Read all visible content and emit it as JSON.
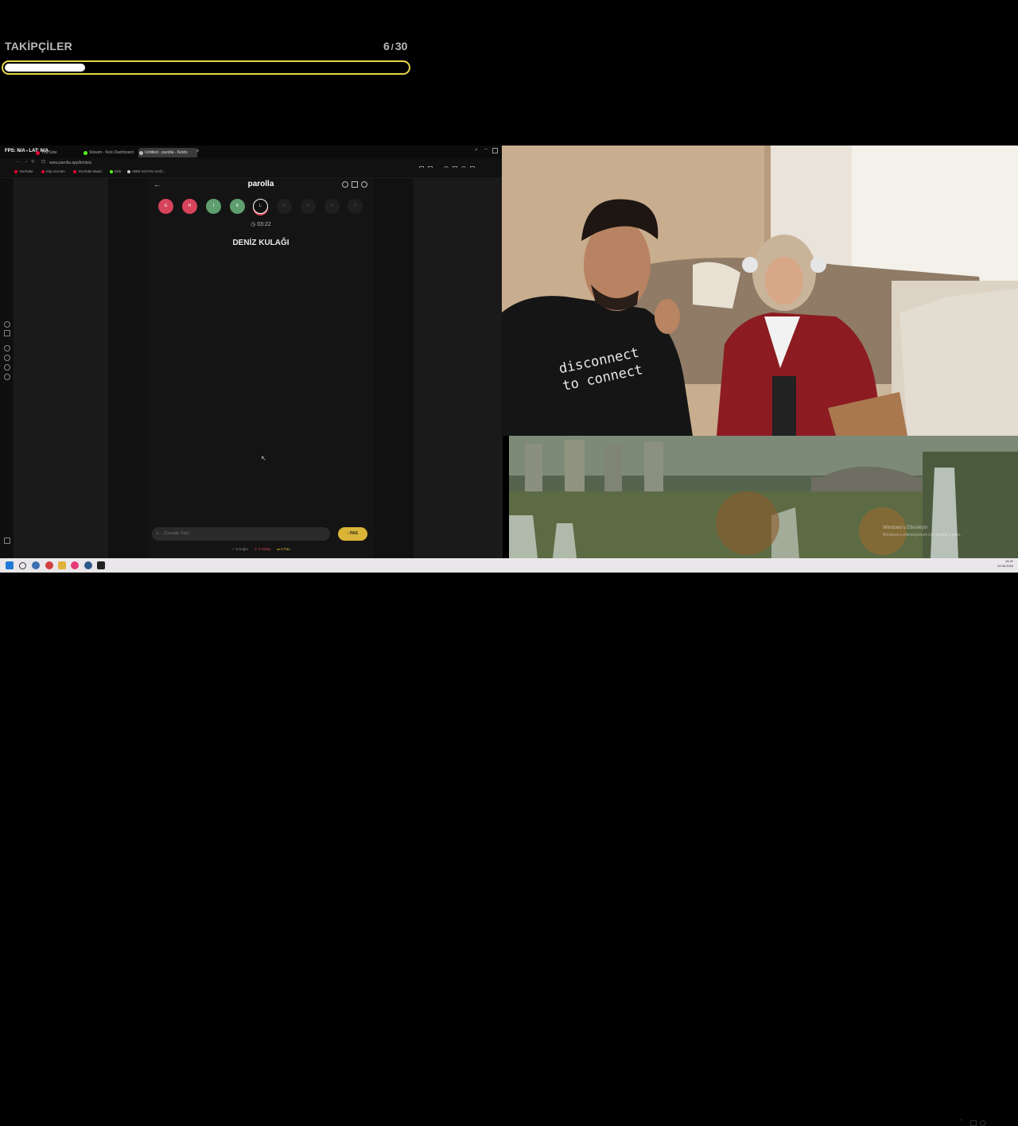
{
  "followers": {
    "title": "TAKİPÇİLER",
    "current": "6",
    "sep": "/",
    "goal": "30",
    "progress": 0.2
  },
  "browser": {
    "tabs": [
      {
        "label": "YouTube",
        "color": "#e03"
      },
      {
        "label": "Stream - Kick Dashboard",
        "color": "#53fc18"
      },
      {
        "label": "Untitled - parolla - Kiddo",
        "color": "#bbb"
      }
    ],
    "url": "www.parolla.app/limitsiz",
    "bookmarks": [
      {
        "label": "YouTube",
        "color": "#e03"
      },
      {
        "label": "Kişi Arocam",
        "color": "#e03"
      },
      {
        "label": "YouTube Music",
        "color": "#e03"
      },
      {
        "label": "Kick",
        "color": "#53fc18"
      },
      {
        "label": "ABDİ SUYOU SAĞ...",
        "color": "#ccc"
      }
    ],
    "overlay_text": "FPS: N/A  ⬝ LAT: N/A"
  },
  "game": {
    "title": "parolla",
    "letters": [
      {
        "char": "G",
        "state": "wrong"
      },
      {
        "char": "H",
        "state": "wrong"
      },
      {
        "char": "I",
        "state": "correct"
      },
      {
        "char": "K",
        "state": "correct"
      },
      {
        "char": "L",
        "state": "current"
      },
      {
        "char": "M",
        "state": "pending"
      },
      {
        "char": "N",
        "state": "pending"
      },
      {
        "char": "O",
        "state": "pending"
      },
      {
        "char": "Ö",
        "state": "pending"
      }
    ],
    "timer": "03:22",
    "question": "DENİZ KULAĞI",
    "answer_placeholder": "L... (Cevabı Yaz)",
    "pass_label": "PAS",
    "stats": {
      "correct": "8 Doğru",
      "wrong": "3 Yanlış",
      "pass": "0 Pas"
    },
    "colors": {
      "wrong": "#d6445a",
      "correct": "#5f9e6e",
      "pending": "#1f1f1f",
      "accent": "#d9b437"
    }
  },
  "desktop": {
    "watermark_title": "Windows'u Etkinleştir",
    "watermark_sub": "Windows'u etkinleştirmek için Ayarlar'a gidin."
  },
  "taskbar": {
    "time": "14:21",
    "date": "10.08.2024"
  }
}
